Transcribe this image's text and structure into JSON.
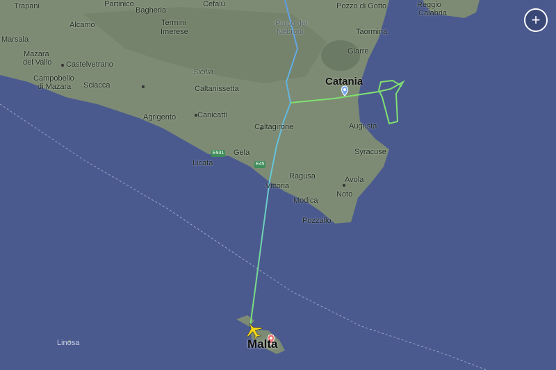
{
  "map": {
    "labels": {
      "partinico": "Partinico",
      "messina_top": "",
      "cefalu": "Cefalù",
      "pozzo_di_gotto": "Pozzo di Gotto",
      "reggio": "Reggio",
      "calabria": "Calabria",
      "trapani": "Trapani",
      "bagheria": "Bagheria",
      "alcamo": "Alcamo",
      "termini": "Termini",
      "imerese": "Imerese",
      "parco_dei": "Parco dei",
      "nebrodi": "Nebrodi",
      "taormina": "Taormina",
      "marsala": "Marsala",
      "mazara": "Mazara",
      "del_vallo": "del Vallo",
      "castelvetrano": "Castelvetrano",
      "sicilia": "Sicilia",
      "giarre": "Giarre",
      "campobello": "Campobello",
      "di_mazara": "di Mazara",
      "sciacca": "Sciacca",
      "caltanissetta": "Caltanissetta",
      "catania": "Catania",
      "agrigento": "Agrigento",
      "canicatti": "Canicattì",
      "caltagirone": "Caltagirone",
      "augusta": "Augusta",
      "gela": "Gela",
      "licata": "Licata",
      "syracuse": "Syracuse",
      "ragusa": "Ragusa",
      "vittoria": "Vittoria",
      "avola": "Avola",
      "noto": "Noto",
      "modica": "Modica",
      "pozzallo": "Pozzallo",
      "linosa": "Linosa",
      "malta": "Malta"
    },
    "road_shields": {
      "e931": "E931",
      "e45": "E45"
    },
    "colors": {
      "sea": "#4b5a8e",
      "land": "#7d8b74",
      "track_start": "#5f9de8",
      "track_end": "#7fe070",
      "pin_origin": "#7aa8f0",
      "pin_destination": "#f06a6a",
      "airplane": "#f2d518"
    },
    "icons": {
      "zoom": "plus-icon",
      "plane": "airplane-icon",
      "origin": "location-pin-icon",
      "destination": "location-pin-icon"
    }
  },
  "controls": {
    "zoom_label": "+"
  }
}
